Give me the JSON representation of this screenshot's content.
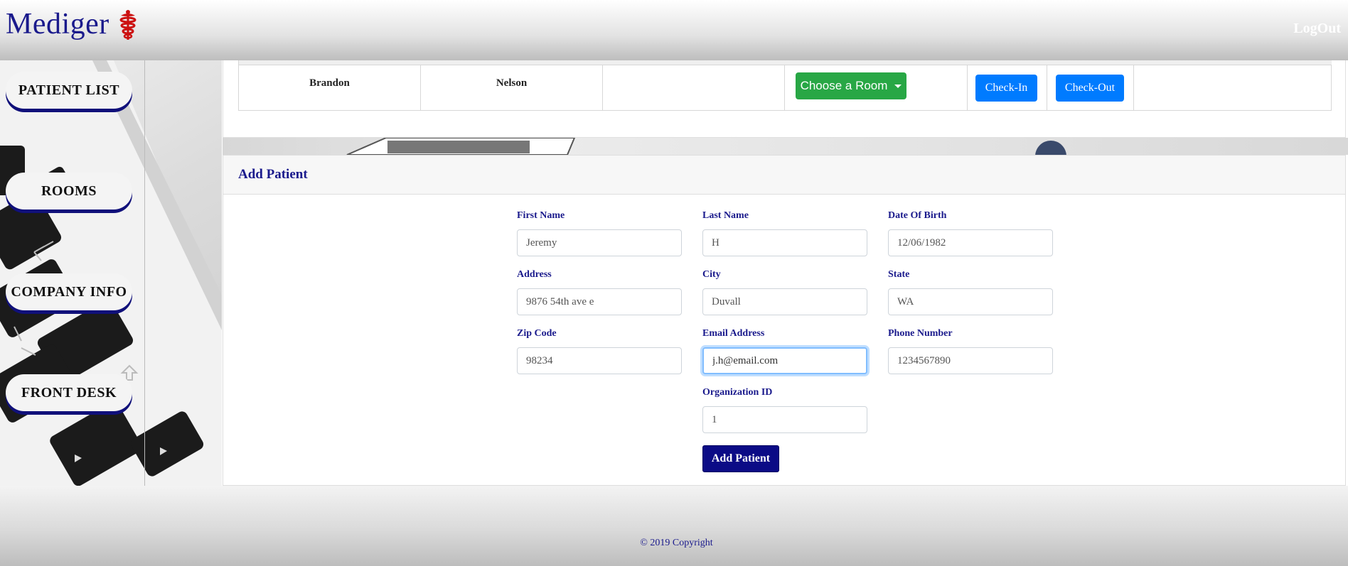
{
  "header": {
    "brand": "Mediger",
    "logout_label": "LogOut"
  },
  "sidebar": {
    "items": [
      {
        "label": "PATIENT LIST"
      },
      {
        "label": "ROOMS"
      },
      {
        "label": "COMPANY INFO"
      },
      {
        "label": "FRONT DESK"
      }
    ]
  },
  "patient_table": {
    "row": {
      "first_name": "Brandon",
      "last_name": "Nelson",
      "room_dropdown": "Choose a Room",
      "check_in": "Check-In",
      "check_out": "Check-Out"
    }
  },
  "add_patient": {
    "title": "Add Patient",
    "fields": {
      "first_name": {
        "label": "First Name",
        "value": "Jeremy"
      },
      "last_name": {
        "label": "Last Name",
        "value": "H"
      },
      "dob": {
        "label": "Date Of Birth",
        "value": "12/06/1982"
      },
      "address": {
        "label": "Address",
        "value": "9876 54th ave e"
      },
      "city": {
        "label": "City",
        "value": "Duvall"
      },
      "state": {
        "label": "State",
        "value": "WA"
      },
      "zip": {
        "label": "Zip Code",
        "value": "98234"
      },
      "email": {
        "label": "Email Address",
        "value": "j.h@email.com"
      },
      "phone": {
        "label": "Phone Number",
        "value": "1234567890"
      },
      "org_id": {
        "label": "Organization ID",
        "value": "1"
      }
    },
    "submit_label": "Add Patient"
  },
  "footer": {
    "copyright": "© 2019 Copyright"
  },
  "colors": {
    "brand_navy": "#1a1a8c",
    "success_green": "#28a745",
    "primary_blue": "#007bff"
  }
}
